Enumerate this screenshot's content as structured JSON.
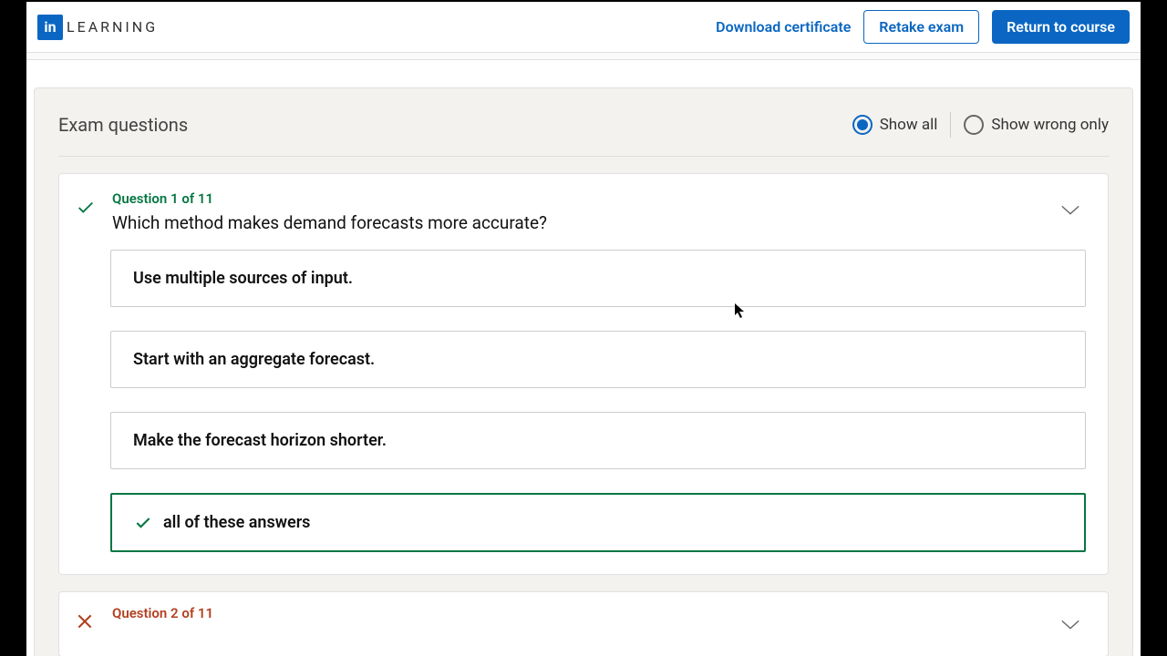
{
  "brand": {
    "box": "in",
    "word": "LEARNING"
  },
  "header": {
    "download": "Download certificate",
    "retake": "Retake exam",
    "return": "Return to course"
  },
  "panel": {
    "title": "Exam questions",
    "filter_all": "Show all",
    "filter_wrong": "Show wrong only"
  },
  "q1": {
    "num": "Question 1 of 11",
    "prompt": "Which method makes demand forecasts more accurate?",
    "a1": "Use multiple sources of input.",
    "a2": "Start with an aggregate forecast.",
    "a3": "Make the forecast horizon shorter.",
    "a4": "all of these answers"
  },
  "q2": {
    "num": "Question 2 of 11"
  }
}
